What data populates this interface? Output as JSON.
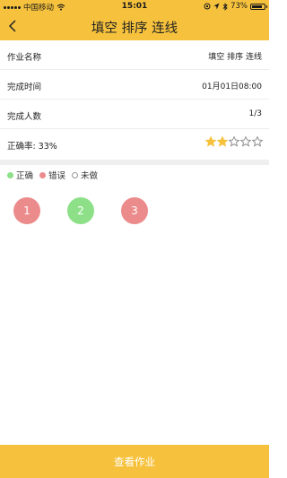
{
  "colors": {
    "accent": "#f6c23d",
    "correct": "#8de088",
    "wrong": "#ec8b8b",
    "star_filled": "#f6c23d",
    "star_empty": "#888888"
  },
  "status_bar": {
    "carrier": "中国移动",
    "time": "15:01",
    "battery": "73%"
  },
  "header": {
    "back_icon": "chevron-left-icon",
    "title": "填空 排序 连线"
  },
  "info": {
    "name_label": "作业名称",
    "name_value": "填空 排序 连线",
    "finish_time_label": "完成时间",
    "finish_time_value": "01月01日08:00",
    "finish_count_label": "完成人数",
    "finish_count_value": "1/3",
    "accuracy_label": "正确率: 33%",
    "rating": {
      "filled": 2,
      "total": 5
    }
  },
  "legend": {
    "correct": "正确",
    "wrong": "错误",
    "undone": "未做"
  },
  "questions": [
    {
      "number": "1",
      "status": "wrong"
    },
    {
      "number": "2",
      "status": "correct"
    },
    {
      "number": "3",
      "status": "wrong"
    }
  ],
  "footer": {
    "view_button": "查看作业"
  }
}
